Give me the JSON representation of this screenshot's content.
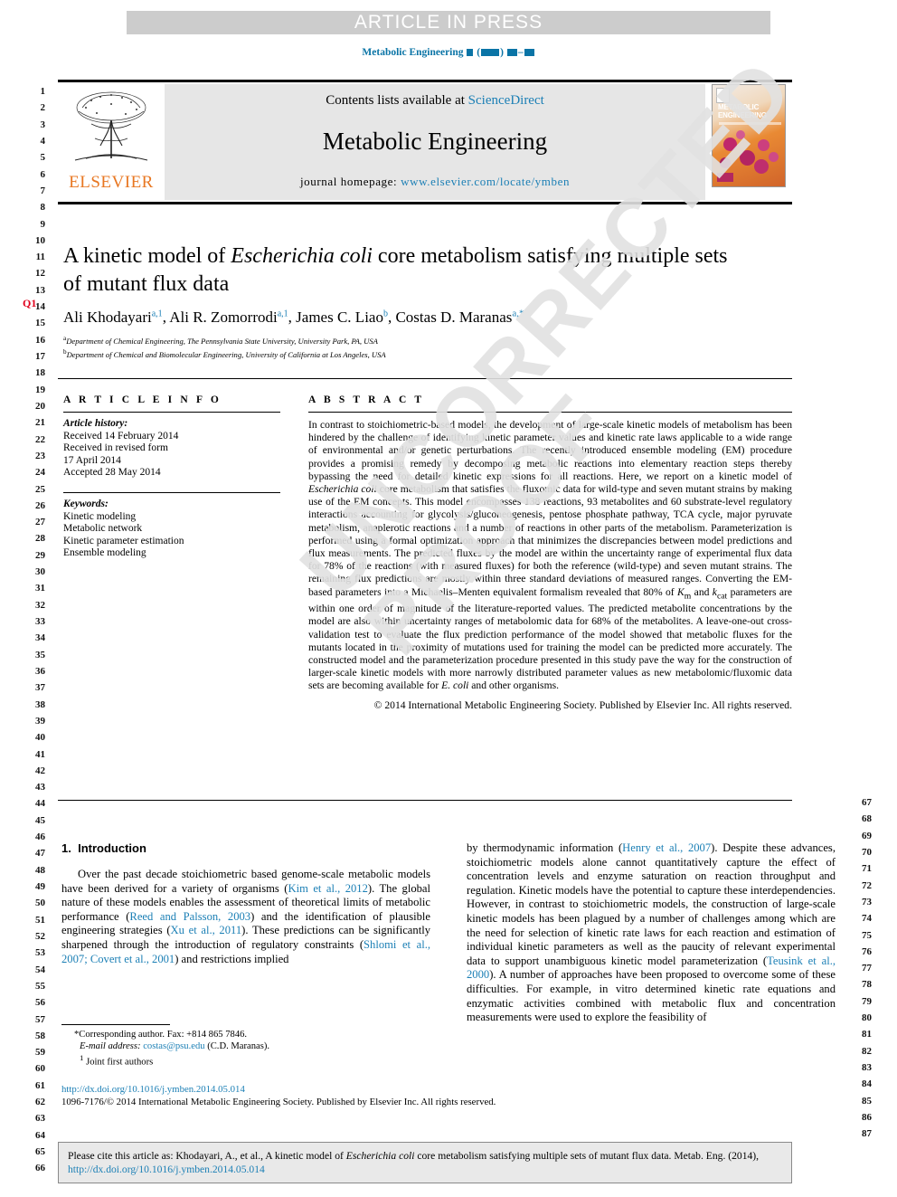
{
  "banner": {
    "text": "ARTICLE IN PRESS"
  },
  "running_head": {
    "journal": "Metabolic Engineering"
  },
  "masthead": {
    "publisher": "ELSEVIER",
    "contents_prefix": "Contents lists available at ",
    "contents_link": "ScienceDirect",
    "journal_title": "Metabolic Engineering",
    "homepage_prefix": "journal homepage: ",
    "homepage_link": "www.elsevier.com/locate/ymben",
    "cover_title_line1": "METABOLIC",
    "cover_title_line2": "ENGINEERING"
  },
  "article": {
    "title_part1": "A kinetic model of ",
    "title_italic": "Escherichia coli",
    "title_part2": " core metabolism satisfying multiple sets of mutant flux data",
    "authors": [
      {
        "name": "Ali Khodayari",
        "marks": "a,1",
        "sep": ", "
      },
      {
        "name": "Ali R. Zomorrodi",
        "marks": "a,1",
        "sep": ", "
      },
      {
        "name": "James C. Liao",
        "marks": "b",
        "sep": ", "
      },
      {
        "name": "Costas D. Maranas",
        "marks": "a,*",
        "sep": ""
      }
    ],
    "affiliations": [
      {
        "mark": "a",
        "text": "Department of Chemical Engineering, The Pennsylvania State University, University Park, PA, USA"
      },
      {
        "mark": "b",
        "text": "Department of Chemical and Biomolecular Engineering, University of California at Los Angeles, USA"
      }
    ]
  },
  "article_info": {
    "heading": "A R T I C L E  I N F O",
    "history_label": "Article history:",
    "history": [
      "Received 14 February 2014",
      "Received in revised form",
      "17 April 2014",
      "Accepted 28 May 2014"
    ],
    "keywords_label": "Keywords:",
    "keywords": [
      "Kinetic modeling",
      "Metabolic network",
      "Kinetic parameter estimation",
      "Ensemble modeling"
    ]
  },
  "abstract": {
    "heading": "A B S T R A C T",
    "p1": "In contrast to stoichiometric-based models, the development of large-scale kinetic models of metabolism has been hindered by the challenge of identifying kinetic parameter values and kinetic rate laws applicable to a wide range of environmental and/or genetic perturbations. The recently introduced ensemble modeling (EM) procedure provides a promising remedy by decomposing metabolic reactions into elementary reaction steps thereby bypassing the need for detailed kinetic expressions for all reactions. Here, we report on a kinetic model of ",
    "species1": "Escherichia coli",
    "p2": " core metabolism that satisfies the fluxomic data for wild-type and seven mutant strains by making use of the EM concepts. This model encompasses 138 reactions, 93 metabolites and 60 substrate-level regulatory interactions accounting for glycolysis/gluconeogenesis, pentose phosphate pathway, TCA cycle, major pyruvate metabolism, anaplerotic reactions and a number of reactions in other parts of the metabolism. Parameterization is performed using a formal optimization approach that minimizes the discrepancies between model predictions and flux measurements. The predicted fluxes by the model are within the uncertainty range of experimental flux data for 78% of the reactions (with measured fluxes) for both the reference (wild-type) and seven mutant strains. The remaining flux predictions are mostly within three standard deviations of measured ranges. Converting the EM-based parameters into a Michaelis–Menten equivalent formalism revealed that 80% of ",
    "km": "K",
    "km_sub": "m",
    "p3": " and ",
    "kcat": "k",
    "kcat_sub": "cat",
    "p4": " parameters are within one order of magnitude of the literature-reported values. The predicted metabolite concentrations by the model are also within uncertainty ranges of metabolomic data for 68% of the metabolites. A leave-one-out cross-validation test to evaluate the flux prediction performance of the model showed that metabolic fluxes for the mutants located in the proximity of mutations used for training the model can be predicted more accurately. The constructed model and the parameterization procedure presented in this study pave the way for the construction of larger-scale kinetic models with more narrowly distributed parameter values as new metabolomic/fluxomic data sets are becoming available for ",
    "species2": "E. coli",
    "p5": " and other organisms.",
    "copyright": "© 2014 International Metabolic Engineering Society. Published by Elsevier Inc. All rights reserved."
  },
  "body": {
    "section_number": "1.",
    "section_title": "Introduction",
    "left_para_1": "Over the past decade stoichiometric based genome-scale metabolic models have been derived for a variety of organisms (",
    "cite_kim": "Kim et al., 2012",
    "left_para_2": "). The global nature of these models enables the assessment of theoretical limits of metabolic performance (",
    "cite_reed": "Reed and Palsson, 2003",
    "left_para_3": ") and the identification of plausible engineering strategies (",
    "cite_xu": "Xu et al., 2011",
    "left_para_4": "). These predictions can be significantly sharpened through the introduction of regulatory constraints (",
    "cite_shlomi": "Shlomi et al., 2007; Covert et al., 2001",
    "left_para_5": ") and restrictions implied",
    "right_para_1": "by thermodynamic information (",
    "cite_henry": "Henry et al., 2007",
    "right_para_2": "). Despite these advances, stoichiometric models alone cannot quantitatively capture the effect of concentration levels and enzyme saturation on reaction throughput and regulation. Kinetic models have the potential to capture these interdependencies. However, in contrast to stoichiometric models, the construction of large-scale kinetic models has been plagued by a number of challenges among which are the need for selection of kinetic rate laws for each reaction and estimation of individual kinetic parameters as well as the paucity of relevant experimental data to support unambiguous kinetic model parameterization (",
    "cite_teusink": "Teusink et al., 2000",
    "right_para_3": "). A number of approaches have been proposed to overcome some of these difficulties. For example, in vitro determined kinetic rate equations and enzymatic activities combined with metabolic flux and concentration measurements were used to explore the feasibility of"
  },
  "footnotes": {
    "corresponding": "*Corresponding author. Fax: +814 865 7846.",
    "email_label": "E-mail address:",
    "email": "costas@psu.edu",
    "email_suffix": " (C.D. Maranas).",
    "joint_mark": "1",
    "joint": " Joint first authors",
    "doi": "http://dx.doi.org/10.1016/j.ymben.2014.05.014",
    "issn": "1096-7176/© 2014 International Metabolic Engineering Society. Published by Elsevier Inc. All rights reserved."
  },
  "cite_box": {
    "prefix": "Please cite this article as: Khodayari, A., et al., A kinetic model of ",
    "italic": "Escherichia coli",
    "middle": " core metabolism satisfying multiple sets of mutant flux data. Metab. Eng. (2014), ",
    "link": "http://dx.doi.org/10.1016/j.ymben.2014.05.014"
  },
  "markers": {
    "query": "Q1",
    "line_numbers_left_start": 1,
    "line_numbers_left_end": 66,
    "line_numbers_right_start": 67,
    "line_numbers_right_end": 87
  },
  "watermark": {
    "text": "UNCORRECTED PROOF"
  },
  "colors": {
    "link": "#1b7fb5",
    "banner_bg": "#cccccc",
    "masthead_bg": "#e6e6e6",
    "elsevier_orange": "#e87722",
    "query_red": "#e0001b"
  }
}
